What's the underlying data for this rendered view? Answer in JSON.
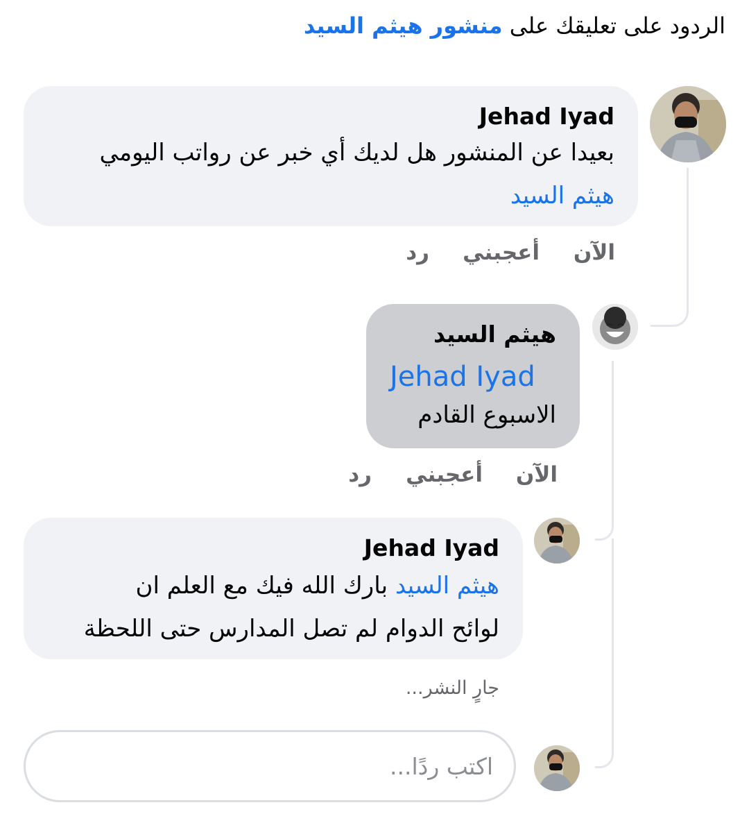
{
  "header": {
    "prefix": "الردود على تعليقك على ",
    "post_link": "منشور هيثم السيد"
  },
  "comment1": {
    "author": "Jehad Iyad",
    "line1": "بعيدا عن المنشور هل لديك أي خبر عن رواتب اليومي",
    "mention": "هيثم السيد",
    "actions": {
      "time": "الآن",
      "like": "أعجبني",
      "reply": "رد"
    }
  },
  "reply1": {
    "author": "هيثم السيد",
    "mention": "Jehad Iyad",
    "line1": "الاسبوع القادم",
    "actions": {
      "time": "الآن",
      "like": "أعجبني",
      "reply": "رد"
    }
  },
  "reply2": {
    "author": "Jehad Iyad",
    "mention": "هيثم السيد",
    "line1_rest": " بارك الله فيك مع العلم ان",
    "line2": "لوائح الدوام لم تصل المدارس حتى اللحظة",
    "status": "جارٍ النشر..."
  },
  "reply_input": {
    "placeholder": "اكتب ردًا..."
  },
  "colors": {
    "link": "#1a73e8",
    "bubble": "#f0f2f5",
    "bubble_dark": "#ccced2",
    "meta": "#65676b"
  }
}
